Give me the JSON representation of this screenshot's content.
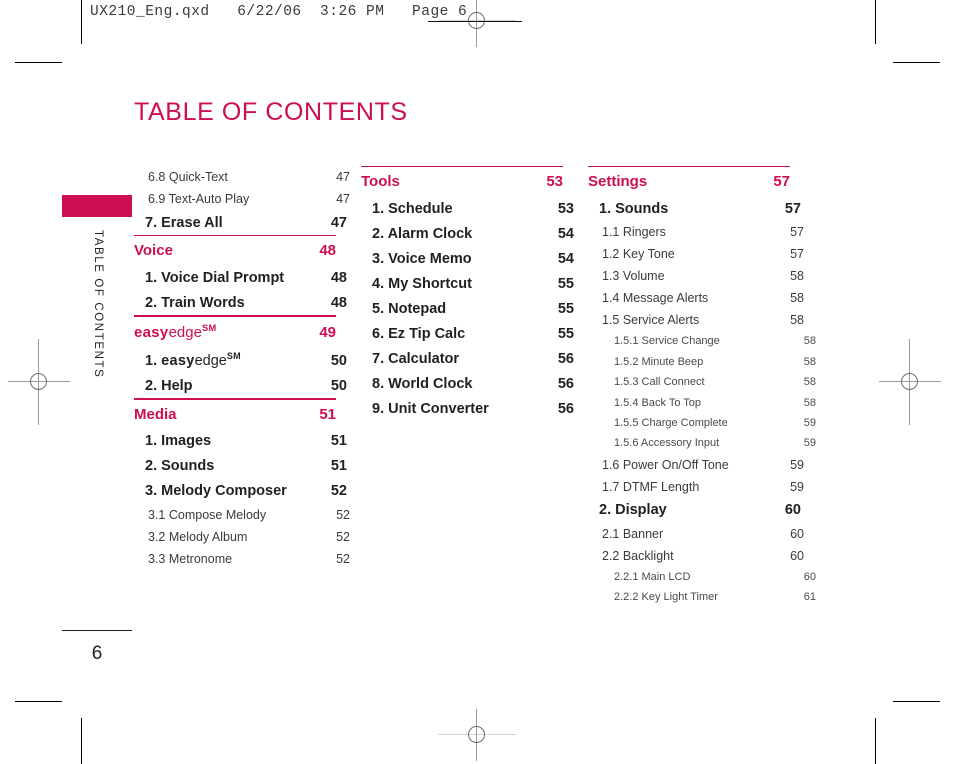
{
  "slug": {
    "text": "UX210_Eng.qxd   6/22/06  3:26 PM   Page 6"
  },
  "side_tab": {
    "label": "TABLE OF CONTENTS",
    "color": "#ce0e53"
  },
  "page_number": "6",
  "title": "TABLE OF CONTENTS",
  "accent_color": "#ce0e53",
  "columns": [
    {
      "name": "column-1",
      "sections": [
        {
          "rule": false,
          "header": null,
          "entries": [
            {
              "level": 2,
              "label": "6.8 Quick-Text",
              "page": "47"
            },
            {
              "level": 2,
              "label": "6.9 Text-Auto Play",
              "page": "47"
            },
            {
              "level": 1,
              "label": "7. Erase All",
              "page": "47"
            }
          ]
        },
        {
          "rule": true,
          "header": {
            "label": "Voice",
            "page": "48"
          },
          "entries": [
            {
              "level": 1,
              "label": "1. Voice Dial Prompt",
              "page": "48"
            },
            {
              "level": 1,
              "label": "2. Train Words",
              "page": "48"
            }
          ]
        },
        {
          "rule": true,
          "header": {
            "label": "easyedge",
            "page": "49",
            "brand": true
          },
          "entries": [
            {
              "level": 1,
              "label": "1. easyedge",
              "page": "50",
              "brand": true,
              "prefix": "1. "
            },
            {
              "level": 1,
              "label": "2. Help",
              "page": "50"
            }
          ]
        },
        {
          "rule": true,
          "header": {
            "label": "Media",
            "page": "51"
          },
          "entries": [
            {
              "level": 1,
              "label": "1. Images",
              "page": "51"
            },
            {
              "level": 1,
              "label": "2. Sounds",
              "page": "51"
            },
            {
              "level": 1,
              "label": "3. Melody Composer",
              "page": "52"
            },
            {
              "level": 2,
              "label": "3.1 Compose Melody",
              "page": "52"
            },
            {
              "level": 2,
              "label": "3.2 Melody Album",
              "page": "52"
            },
            {
              "level": 2,
              "label": "3.3 Metronome",
              "page": "52"
            }
          ]
        }
      ]
    },
    {
      "name": "column-2",
      "sections": [
        {
          "rule": true,
          "header": {
            "label": "Tools",
            "page": "53"
          },
          "entries": [
            {
              "level": 1,
              "label": "1. Schedule",
              "page": "53"
            },
            {
              "level": 1,
              "label": "2. Alarm Clock",
              "page": "54"
            },
            {
              "level": 1,
              "label": "3. Voice Memo",
              "page": "54"
            },
            {
              "level": 1,
              "label": "4. My Shortcut",
              "page": "55"
            },
            {
              "level": 1,
              "label": "5. Notepad",
              "page": "55"
            },
            {
              "level": 1,
              "label": "6. Ez Tip Calc",
              "page": "55"
            },
            {
              "level": 1,
              "label": "7. Calculator",
              "page": "56"
            },
            {
              "level": 1,
              "label": "8. World Clock",
              "page": "56"
            },
            {
              "level": 1,
              "label": "9. Unit Converter",
              "page": "56"
            }
          ]
        }
      ]
    },
    {
      "name": "column-3",
      "sections": [
        {
          "rule": true,
          "header": {
            "label": "Settings",
            "page": "57"
          },
          "entries": [
            {
              "level": 1,
              "label": "1. Sounds",
              "page": "57"
            },
            {
              "level": 2,
              "label": "1.1 Ringers",
              "page": "57"
            },
            {
              "level": 2,
              "label": "1.2 Key Tone",
              "page": "57"
            },
            {
              "level": 2,
              "label": "1.3 Volume",
              "page": "58"
            },
            {
              "level": 2,
              "label": "1.4 Message Alerts",
              "page": "58"
            },
            {
              "level": 2,
              "label": "1.5 Service Alerts",
              "page": "58"
            },
            {
              "level": 3,
              "label": "1.5.1 Service Change",
              "page": "58"
            },
            {
              "level": 3,
              "label": "1.5.2 Minute Beep",
              "page": "58"
            },
            {
              "level": 3,
              "label": "1.5.3 Call Connect",
              "page": "58"
            },
            {
              "level": 3,
              "label": "1.5.4 Back To Top",
              "page": "58"
            },
            {
              "level": 3,
              "label": "1.5.5 Charge Complete",
              "page": "59"
            },
            {
              "level": 3,
              "label": "1.5.6 Accessory Input",
              "page": "59"
            },
            {
              "level": 2,
              "label": "1.6 Power On/Off Tone",
              "page": "59"
            },
            {
              "level": 2,
              "label": "1.7 DTMF Length",
              "page": "59"
            },
            {
              "level": 1,
              "label": "2. Display",
              "page": "60"
            },
            {
              "level": 2,
              "label": "2.1 Banner",
              "page": "60"
            },
            {
              "level": 2,
              "label": "2.2 Backlight",
              "page": "60"
            },
            {
              "level": 3,
              "label": "2.2.1 Main LCD",
              "page": "60"
            },
            {
              "level": 3,
              "label": "2.2.2 Key Light Timer",
              "page": "61"
            }
          ]
        }
      ]
    }
  ],
  "brand": {
    "easy": "easy",
    "edge": "edge",
    "sm": "SM"
  }
}
